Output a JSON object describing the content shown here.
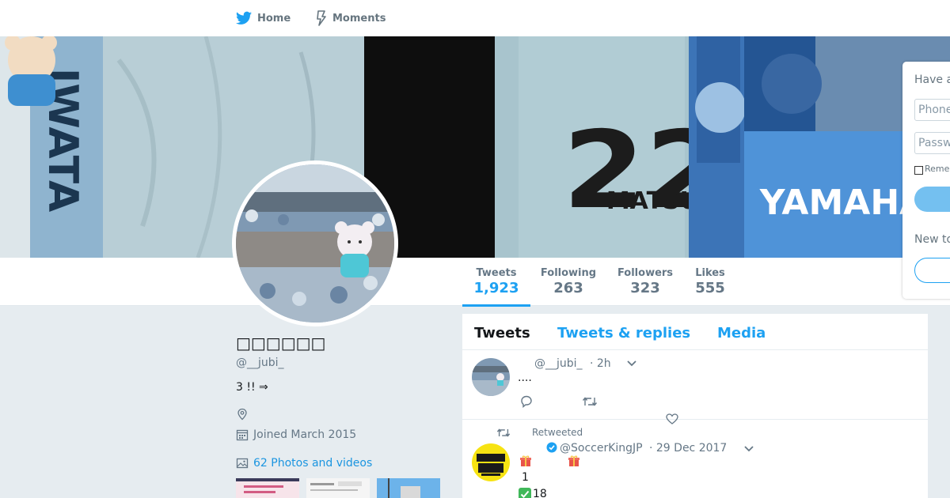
{
  "nav": {
    "home_label": "Home",
    "moments_label": "Moments"
  },
  "profile": {
    "name": "□□□□□□",
    "handle": "@__jubi_",
    "bio": "3 !!  ⇒",
    "joined": "Joined March 2015",
    "photos_link": "62 Photos and videos"
  },
  "stats": [
    {
      "label": "Tweets",
      "value": "1,923"
    },
    {
      "label": "Following",
      "value": "263"
    },
    {
      "label": "Followers",
      "value": "323"
    },
    {
      "label": "Likes",
      "value": "555"
    }
  ],
  "login": {
    "heading": "Have a",
    "phone_placeholder": "Phone",
    "password_placeholder": "Passw",
    "remember": "Reme",
    "new_to": "New to"
  },
  "timeline": {
    "tabs": [
      "Tweets",
      "Tweets & replies",
      "Media"
    ],
    "tweets": [
      {
        "handle": "@__jubi_",
        "time": "· 2h",
        "text": "...."
      },
      {
        "retweet_label": "Retweeted",
        "handle": "@SoccerKingJP",
        "time": "· 29 Dec 2017",
        "line1": "1",
        "line2": "18"
      }
    ]
  },
  "banner": {
    "jersey_number": "22",
    "jersey_name": "MATSUI",
    "sponsor": "YAMAHA",
    "side_text": "IWATA"
  },
  "colors": {
    "accent": "#1da1f2",
    "background": "#e6ecf0",
    "muted": "#657786"
  }
}
